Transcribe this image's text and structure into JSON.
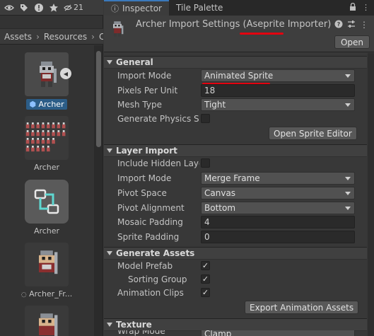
{
  "project": {
    "toolbar": {
      "icons": [
        "eye-icon",
        "tag-icon",
        "warning-icon",
        "star-icon",
        "visibility-count-icon"
      ],
      "hidden_count": "21"
    },
    "breadcrumb": [
      "Assets",
      "Resources",
      "C"
    ],
    "assets": [
      {
        "label": "Archer",
        "selected": true,
        "icon": "aseprite-asset-icon"
      },
      {
        "label": "Archer",
        "selected": false,
        "icon": "sprite-sheet-icon"
      },
      {
        "label": "Archer",
        "selected": false,
        "icon": "animator-controller-icon"
      },
      {
        "label": "Archer_Fr...",
        "selected": false,
        "icon": "sprite-icon"
      },
      {
        "label": "",
        "selected": false,
        "icon": "sprite-icon"
      }
    ]
  },
  "inspector": {
    "tabs": [
      {
        "label": "Inspector",
        "active": true,
        "icon": "info-icon"
      },
      {
        "label": "Tile Palette",
        "active": false,
        "icon": ""
      }
    ],
    "title": "Archer Import Settings (Aseprite Importer)",
    "open_label": "Open",
    "sections": {
      "general": {
        "title": "General",
        "import_mode_label": "Import Mode",
        "import_mode_value": "Animated Sprite",
        "ppu_label": "Pixels Per Unit",
        "ppu_value": "18",
        "mesh_type_label": "Mesh Type",
        "mesh_type_value": "Tight",
        "physics_label": "Generate Physics Sh",
        "physics_checked": false,
        "open_sprite_editor_label": "Open Sprite Editor"
      },
      "layer_import": {
        "title": "Layer Import",
        "include_hidden_label": "Include Hidden Laye",
        "include_hidden_checked": false,
        "import_mode_label": "Import Mode",
        "import_mode_value": "Merge Frame",
        "pivot_space_label": "Pivot Space",
        "pivot_space_value": "Canvas",
        "pivot_alignment_label": "Pivot Alignment",
        "pivot_alignment_value": "Bottom",
        "mosaic_padding_label": "Mosaic Padding",
        "mosaic_padding_value": "4",
        "sprite_padding_label": "Sprite Padding",
        "sprite_padding_value": "0"
      },
      "generate_assets": {
        "title": "Generate Assets",
        "model_prefab_label": "Model Prefab",
        "sorting_group_label": "Sorting Group",
        "animation_clips_label": "Animation Clips",
        "check_glyph": "✓",
        "export_label": "Export Animation Assets"
      },
      "texture": {
        "title": "Texture",
        "wrap_mode_label": "Wrap Mode",
        "wrap_mode_value": "Clamp"
      }
    }
  },
  "colors": {
    "highlight_underline": "#e3000f",
    "selection": "#2c5d87",
    "accent_tab": "#3a79bb"
  }
}
